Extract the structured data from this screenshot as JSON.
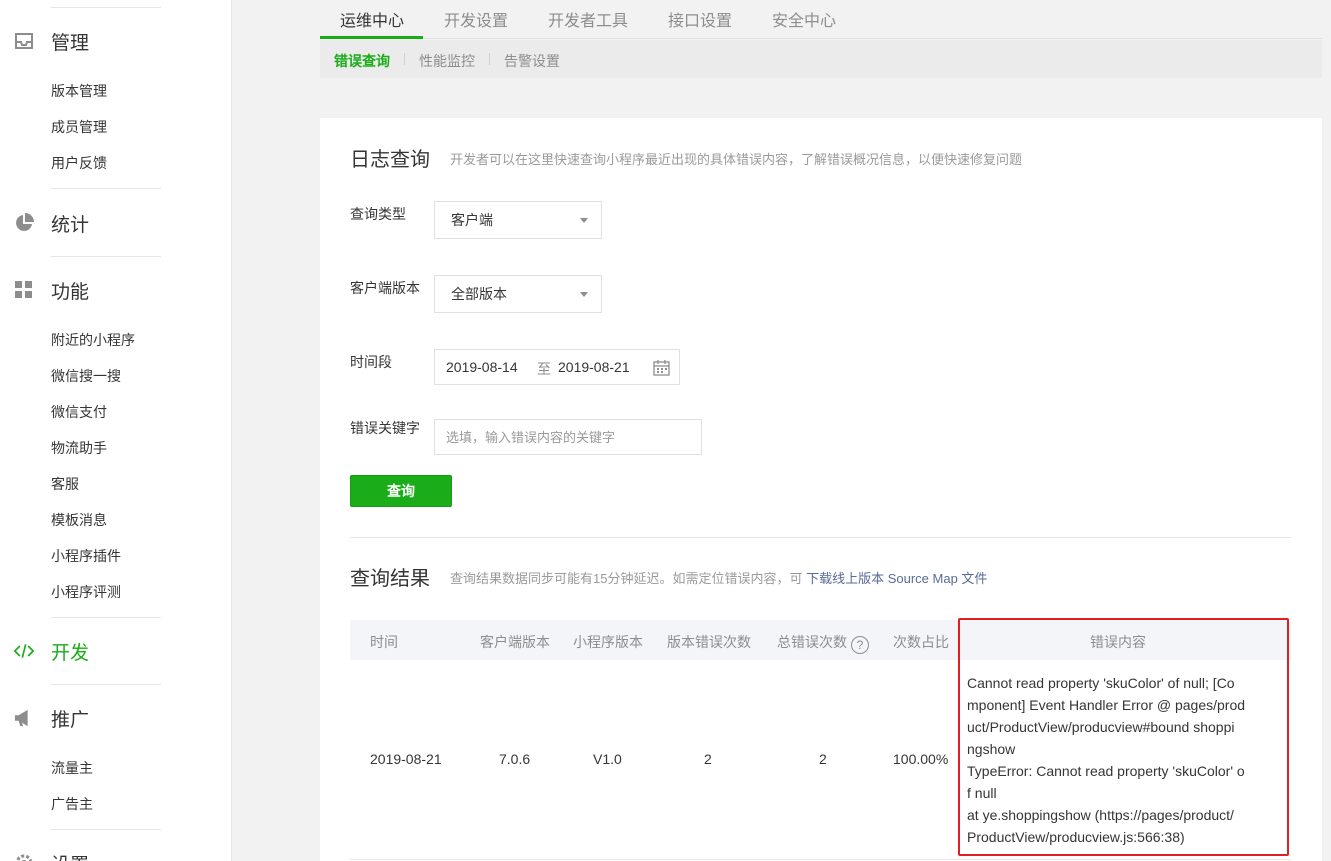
{
  "sidebar": {
    "group_manage": "管理",
    "manage_items": [
      "版本管理",
      "成员管理",
      "用户反馈"
    ],
    "group_stats": "统计",
    "group_features": "功能",
    "feature_items": [
      "附近的小程序",
      "微信搜一搜",
      "微信支付",
      "物流助手",
      "客服",
      "模板消息",
      "小程序插件",
      "小程序评测"
    ],
    "group_dev": "开发",
    "group_promo": "推广",
    "promo_items": [
      "流量主",
      "广告主"
    ],
    "group_settings": "设置"
  },
  "tabs": [
    "运维中心",
    "开发设置",
    "开发者工具",
    "接口设置",
    "安全中心"
  ],
  "active_tab": "运维中心",
  "subtabs": [
    "错误查询",
    "性能监控",
    "告警设置"
  ],
  "active_subtab": "错误查询",
  "log_query": {
    "title": "日志查询",
    "desc": "开发者可以在这里快速查询小程序最近出现的具体错误内容，了解错误概况信息，以便快速修复问题",
    "query_type_label": "查询类型",
    "query_type_value": "客户端",
    "client_version_label": "客户端版本",
    "client_version_value": "全部版本",
    "time_label": "时间段",
    "date_start": "2019-08-14",
    "date_sep": "至",
    "date_end": "2019-08-21",
    "keyword_label": "错误关键字",
    "keyword_placeholder": "选填，输入错误内容的关键字",
    "query_button": "查询"
  },
  "results": {
    "title": "查询结果",
    "desc": "查询结果数据同步可能有15分钟延迟。如需定位错误内容，可",
    "link": "下载线上版本 Source Map 文件",
    "columns": [
      "时间",
      "客户端版本",
      "小程序版本",
      "版本错误次数",
      "总错误次数",
      "次数占比",
      "错误内容"
    ],
    "help_mark": "?",
    "row": {
      "time": "2019-08-21",
      "client_version": "7.0.6",
      "app_version": "V1.0",
      "version_errors": "2",
      "total_errors": "2",
      "ratio": "100.00%",
      "error_lines": [
        "Cannot read property 'skuColor' of null; [Co",
        "mponent] Event Handler Error @ pages/prod",
        "uct/ProductView/producview#bound shoppi",
        "ngshow",
        "TypeError: Cannot read property 'skuColor' o",
        "f null",
        "at ye.shoppingshow (https://pages/product/",
        "ProductView/producview.js:566:38)"
      ]
    }
  },
  "colors": {
    "accent": "#1aad19",
    "highlight_box": "#e02020",
    "link": "#576b95"
  },
  "icons": {
    "manage": "inbox-icon",
    "stats": "pie-chart-icon",
    "features": "grid-icon",
    "dev": "code-icon",
    "promo": "megaphone-icon",
    "settings": "gear-icon",
    "calendar": "calendar-icon",
    "select": "caret-down-icon"
  }
}
